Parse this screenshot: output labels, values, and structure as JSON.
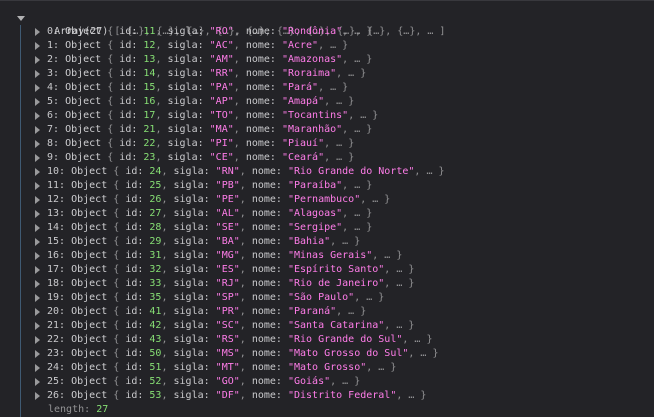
{
  "array_label": "Array(27)",
  "array_preview": "[ {…}, {…}, {…}, {…}, {…}, {…}, {…}, {…}, {…}, {…}, … ]",
  "object_label": "Object",
  "key_id": "id:",
  "key_sigla": "sigla:",
  "key_nome": "nome:",
  "items": [
    {
      "index": "0:",
      "id": "11",
      "sigla": "\"RO\"",
      "nome": "\"Rondônia\""
    },
    {
      "index": "1:",
      "id": "12",
      "sigla": "\"AC\"",
      "nome": "\"Acre\""
    },
    {
      "index": "2:",
      "id": "13",
      "sigla": "\"AM\"",
      "nome": "\"Amazonas\""
    },
    {
      "index": "3:",
      "id": "14",
      "sigla": "\"RR\"",
      "nome": "\"Roraima\""
    },
    {
      "index": "4:",
      "id": "15",
      "sigla": "\"PA\"",
      "nome": "\"Pará\""
    },
    {
      "index": "5:",
      "id": "16",
      "sigla": "\"AP\"",
      "nome": "\"Amapá\""
    },
    {
      "index": "6:",
      "id": "17",
      "sigla": "\"TO\"",
      "nome": "\"Tocantins\""
    },
    {
      "index": "7:",
      "id": "21",
      "sigla": "\"MA\"",
      "nome": "\"Maranhão\""
    },
    {
      "index": "8:",
      "id": "22",
      "sigla": "\"PI\"",
      "nome": "\"Piauí\""
    },
    {
      "index": "9:",
      "id": "23",
      "sigla": "\"CE\"",
      "nome": "\"Ceará\""
    },
    {
      "index": "10:",
      "id": "24",
      "sigla": "\"RN\"",
      "nome": "\"Rio Grande do Norte\""
    },
    {
      "index": "11:",
      "id": "25",
      "sigla": "\"PB\"",
      "nome": "\"Paraíba\""
    },
    {
      "index": "12:",
      "id": "26",
      "sigla": "\"PE\"",
      "nome": "\"Pernambuco\""
    },
    {
      "index": "13:",
      "id": "27",
      "sigla": "\"AL\"",
      "nome": "\"Alagoas\""
    },
    {
      "index": "14:",
      "id": "28",
      "sigla": "\"SE\"",
      "nome": "\"Sergipe\""
    },
    {
      "index": "15:",
      "id": "29",
      "sigla": "\"BA\"",
      "nome": "\"Bahia\""
    },
    {
      "index": "16:",
      "id": "31",
      "sigla": "\"MG\"",
      "nome": "\"Minas Gerais\""
    },
    {
      "index": "17:",
      "id": "32",
      "sigla": "\"ES\"",
      "nome": "\"Espírito Santo\""
    },
    {
      "index": "18:",
      "id": "33",
      "sigla": "\"RJ\"",
      "nome": "\"Rio de Janeiro\""
    },
    {
      "index": "19:",
      "id": "35",
      "sigla": "\"SP\"",
      "nome": "\"São Paulo\""
    },
    {
      "index": "20:",
      "id": "41",
      "sigla": "\"PR\"",
      "nome": "\"Paraná\""
    },
    {
      "index": "21:",
      "id": "42",
      "sigla": "\"SC\"",
      "nome": "\"Santa Catarina\""
    },
    {
      "index": "22:",
      "id": "43",
      "sigla": "\"RS\"",
      "nome": "\"Rio Grande do Sul\""
    },
    {
      "index": "23:",
      "id": "50",
      "sigla": "\"MS\"",
      "nome": "\"Mato Grosso do Sul\""
    },
    {
      "index": "24:",
      "id": "51",
      "sigla": "\"MT\"",
      "nome": "\"Mato Grosso\""
    },
    {
      "index": "25:",
      "id": "52",
      "sigla": "\"GO\"",
      "nome": "\"Goiás\""
    },
    {
      "index": "26:",
      "id": "53",
      "sigla": "\"DF\"",
      "nome": "\"Distrito Federal\""
    }
  ],
  "length_key": "length:",
  "length_value": "27",
  "colors": {
    "background": "#232327",
    "number": "#86de74",
    "string": "#ff7de9",
    "guide": "#3f5a73"
  },
  "icons": {
    "expanded": "triangle-down-icon",
    "collapsed": "triangle-right-icon"
  }
}
